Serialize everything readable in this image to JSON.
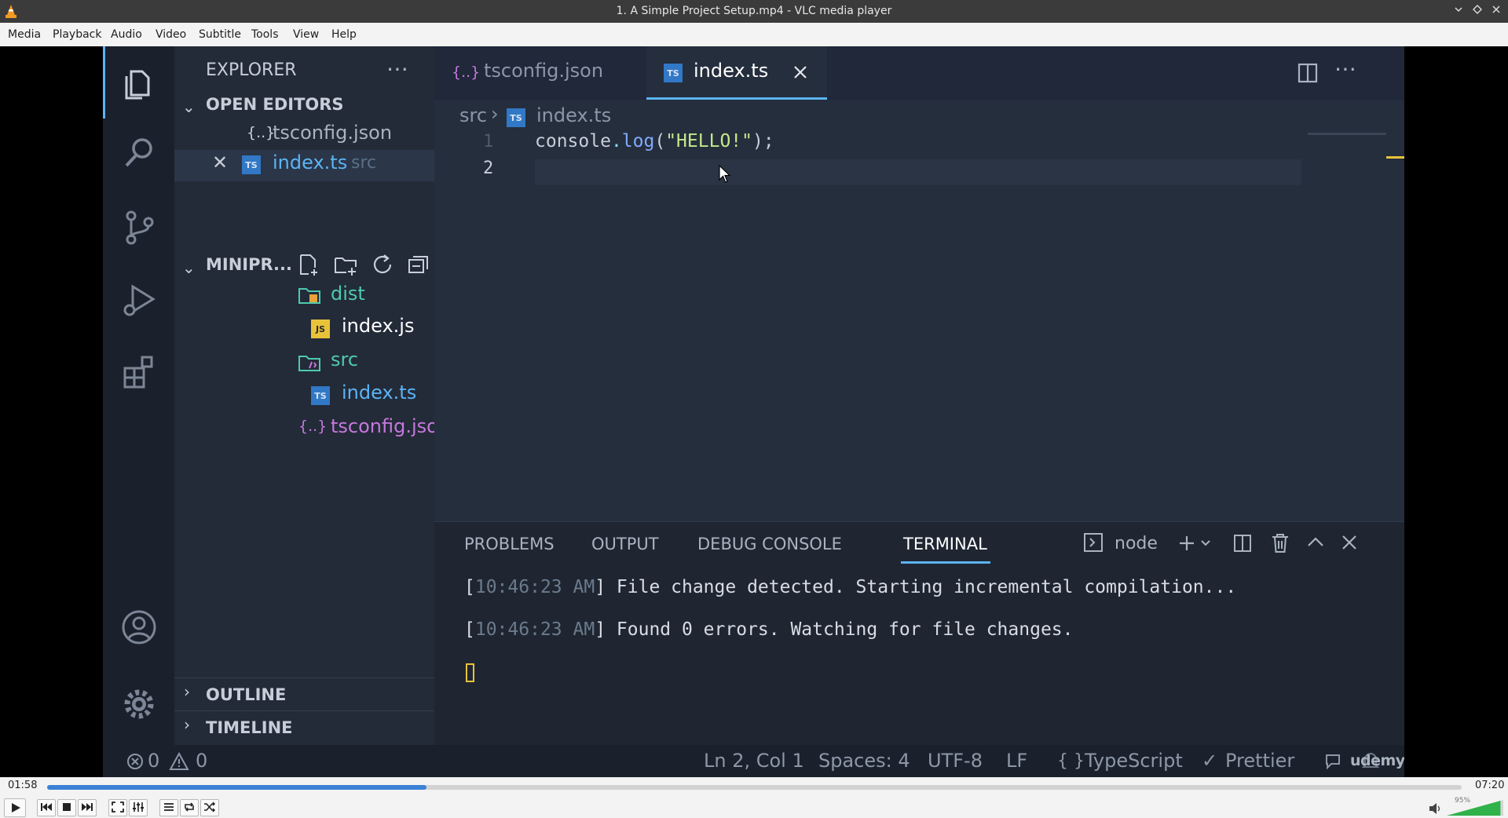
{
  "window": {
    "title": "1. A Simple Project Setup.mp4 - VLC media player"
  },
  "menu": [
    "Media",
    "Playback",
    "Audio",
    "Video",
    "Subtitle",
    "Tools",
    "View",
    "Help"
  ],
  "editor": {
    "tabs": [
      {
        "label": "tsconfig.json"
      },
      {
        "label": "index.ts"
      }
    ],
    "breadcrumb": {
      "folder": "src",
      "file": "index.ts"
    },
    "lines": [
      {
        "number": "1"
      },
      {
        "number": "2"
      }
    ],
    "code": {
      "obj": "console",
      "dot": ".",
      "fn": "log",
      "open": "(",
      "str": "\"HELLO!\"",
      "close": ");"
    }
  },
  "sidebar": {
    "title": "EXPLORER",
    "open_editors_label": "OPEN EDITORS",
    "open_editors": [
      {
        "name": "tsconfig.json",
        "hint": ""
      },
      {
        "name": "index.ts",
        "hint": "src"
      }
    ],
    "project_label": "MINIPR...",
    "tree": [
      {
        "name": "dist"
      },
      {
        "name": "index.js"
      },
      {
        "name": "src"
      },
      {
        "name": "index.ts"
      },
      {
        "name": "tsconfig.json"
      }
    ],
    "outline_label": "OUTLINE",
    "timeline_label": "TIMELINE"
  },
  "panel": {
    "tabs": [
      "PROBLEMS",
      "OUTPUT",
      "DEBUG CONSOLE",
      "TERMINAL"
    ],
    "shell": "node",
    "terminal": [
      {
        "time": "10:46:23",
        "ampm": "AM",
        "msg": "File change detected. Starting incremental compilation..."
      },
      {
        "time": "10:46:23",
        "ampm": "AM",
        "msg": "Found 0 errors. Watching for file changes."
      }
    ]
  },
  "status": {
    "errors": "0",
    "warnings": "0",
    "position": "Ln 2, Col 1",
    "spaces": "Spaces: 4",
    "encoding": "UTF-8",
    "eol": "LF",
    "language": "TypeScript",
    "formatter": "Prettier",
    "watermark": "udemy"
  },
  "player": {
    "elapsed": "01:58",
    "total": "07:20",
    "progress": 0.268,
    "volume_label": "95%",
    "volume": 0.95
  },
  "colors": {
    "accent": "#5bb4f5",
    "folder_teal": "#4ec9b0",
    "js_yellow": "#e8c33a",
    "ts_blue": "#3178c6",
    "string": "#c3e88d"
  }
}
